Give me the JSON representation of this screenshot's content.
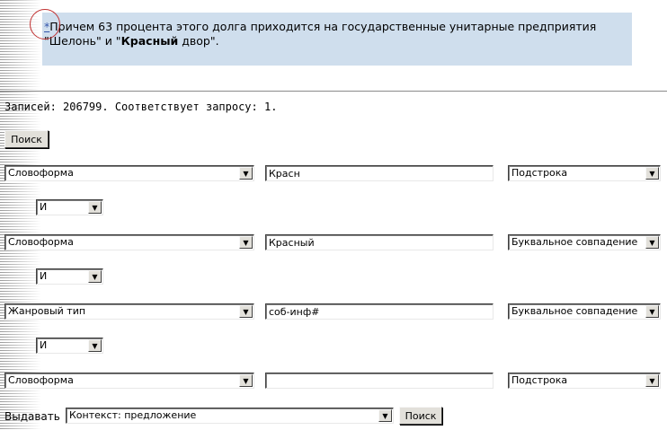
{
  "snippet": {
    "star": "*",
    "line1": "Причем 63 процента этого долга приходится на государственные унитарные предприятия",
    "line2_start": "\"Шелонь\" и \"",
    "line2_bold": "Красный",
    "line2_end": " двор\"."
  },
  "stats": {
    "text": "Записей: 206799. Соответствует запросу: 1."
  },
  "search_button_top": "Поиск",
  "rows": [
    {
      "field": "Словоформа",
      "value": "Красн",
      "match": "Подстрока"
    },
    {
      "field": "Словоформа",
      "value": "Красный",
      "match": "Буквальное совпадение"
    },
    {
      "field": "Жанровый тип",
      "value": "соб-инф#",
      "match": "Буквальное совпадение"
    },
    {
      "field": "Словоформа",
      "value": "",
      "match": "Подстрока"
    }
  ],
  "operators": [
    "И",
    "И",
    "И"
  ],
  "issue": {
    "label": "Выдавать",
    "value": "Контекст: предложение",
    "button": "Поиск"
  },
  "icons": {
    "dropdown": "triangle-down-icon"
  }
}
